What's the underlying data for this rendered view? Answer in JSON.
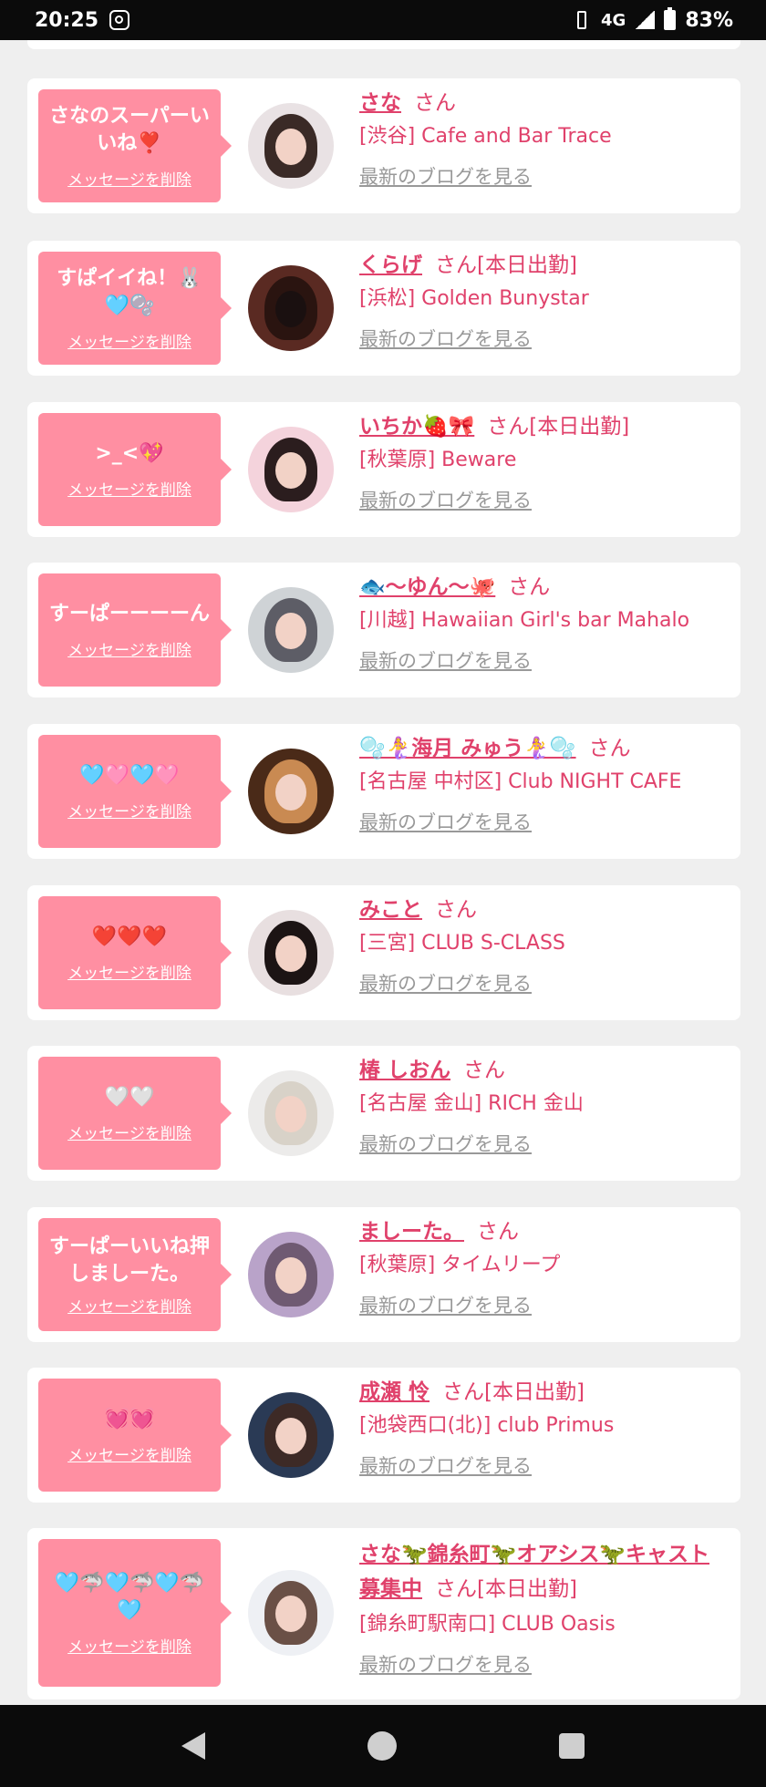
{
  "status_bar": {
    "time": "20:25",
    "network": "4G",
    "battery": "83%"
  },
  "delete_label": "メッセージを削除",
  "blog_label": "最新のブログを見る",
  "cards": [
    {
      "message": "さなのスーパーいいね❣️",
      "name": "さな",
      "suffix": "さん",
      "shop": "[渋谷] Cafe and Bar Trace"
    },
    {
      "message": "すぱイイね！🐰🩵🫧",
      "name": "くらげ",
      "suffix": "さん[本日出勤]",
      "shop": "[浜松] Golden Bunystar"
    },
    {
      "message": ">_<💖",
      "name": "いちか🍓🎀",
      "suffix": "さん[本日出勤]",
      "shop": "[秋葉原] Beware"
    },
    {
      "message": "すーぱーーーーん",
      "name": "🐟～ゆん～🐙",
      "suffix": "さん",
      "shop": "[川越] Hawaiian Girl's bar Mahalo"
    },
    {
      "message": "🩵🩷🩵🩷",
      "name": "🫧🧜‍♀️海月 みゅう🧜‍♀️🫧",
      "suffix": "さん",
      "shop": "[名古屋 中村区] Club NIGHT CAFE"
    },
    {
      "message": "❤️❤️❤️",
      "name": "みこと",
      "suffix": "さん",
      "shop": "[三宮] CLUB S-CLASS"
    },
    {
      "message": "🤍🤍",
      "name": "椿 しおん",
      "suffix": "さん",
      "shop": "[名古屋 金山] RICH 金山"
    },
    {
      "message": "すーぱーいいね押しましーた。",
      "name": "ましーた。",
      "suffix": "さん",
      "shop": "[秋葉原] タイムリープ"
    },
    {
      "message": "💓💓",
      "name": "成瀬 怜",
      "suffix": "さん[本日出勤]",
      "shop": "[池袋西口(北)] club Primus"
    },
    {
      "message": "🩵🦈🩵🦈🩵🦈🩵",
      "name": "さな🦖錦糸町🦖オアシス🦖キャスト募集中",
      "suffix": "さん[本日出勤]",
      "shop": "[錦糸町駅南口] CLUB Oasis"
    }
  ],
  "colors": {
    "accent": "#e0416b",
    "bubble": "#ff8fa2",
    "muted": "#999999"
  }
}
